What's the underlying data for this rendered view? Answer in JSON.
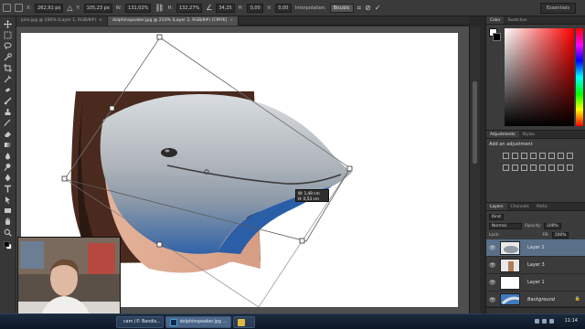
{
  "options_bar": {
    "x_label": "X:",
    "x_value": "262,91 px",
    "y_label": "Y:",
    "y_value": "105,23 px",
    "w_label": "W:",
    "w_value": "131,02%",
    "h_label": "H:",
    "h_value": "132,27%",
    "angle_value": "34,25",
    "hskew_label": "H:",
    "hskew_value": "0,00",
    "vskew_label": "V:",
    "vskew_value": "0,00",
    "interp_label": "Interpolation:",
    "interp_value": "Bicubic",
    "workspace": "Essentials"
  },
  "tabs": [
    {
      "label": "jolie.jpg @ 100% (Layer 1, RGB/8#)",
      "active": false
    },
    {
      "label": "dolphinspeaker.jpg @ 233% (Layer 2, RGB/8#) (CMYK)",
      "active": true
    }
  ],
  "color_panel": {
    "tabs": [
      "Color",
      "Swatches"
    ]
  },
  "adjustments_panel": {
    "tabs": [
      "Adjustments",
      "Styles"
    ],
    "title": "Add an adjustment"
  },
  "layers_panel": {
    "tabs": [
      "Layers",
      "Channels",
      "Paths"
    ],
    "kind_label": "Kind",
    "blend_mode": "Normal",
    "opacity_label": "Opacity:",
    "opacity_value": "100%",
    "lock_label": "Lock:",
    "fill_label": "Fill:",
    "fill_value": "100%",
    "layers": [
      {
        "name": "Layer 2",
        "selected": true,
        "italic": false
      },
      {
        "name": "Layer 3",
        "selected": false,
        "italic": false
      },
      {
        "name": "Layer 1",
        "selected": false,
        "italic": false
      },
      {
        "name": "Background",
        "selected": false,
        "italic": true
      }
    ]
  },
  "transform_hud": {
    "w": "W: 1,49 cm",
    "h": "H: 0,53 cm"
  },
  "taskbar": {
    "items": [
      {
        "label": "cam (© Bandis...",
        "active": false
      },
      {
        "label": "dolphinspeaker.jpg ...",
        "active": true
      },
      {
        "label": "",
        "active": false
      }
    ],
    "clock": "11:14"
  },
  "colors": {
    "accent": "#5a6f88",
    "dolphin_blue": "#3f6fb2",
    "panel_bg": "#3b3b3b"
  }
}
